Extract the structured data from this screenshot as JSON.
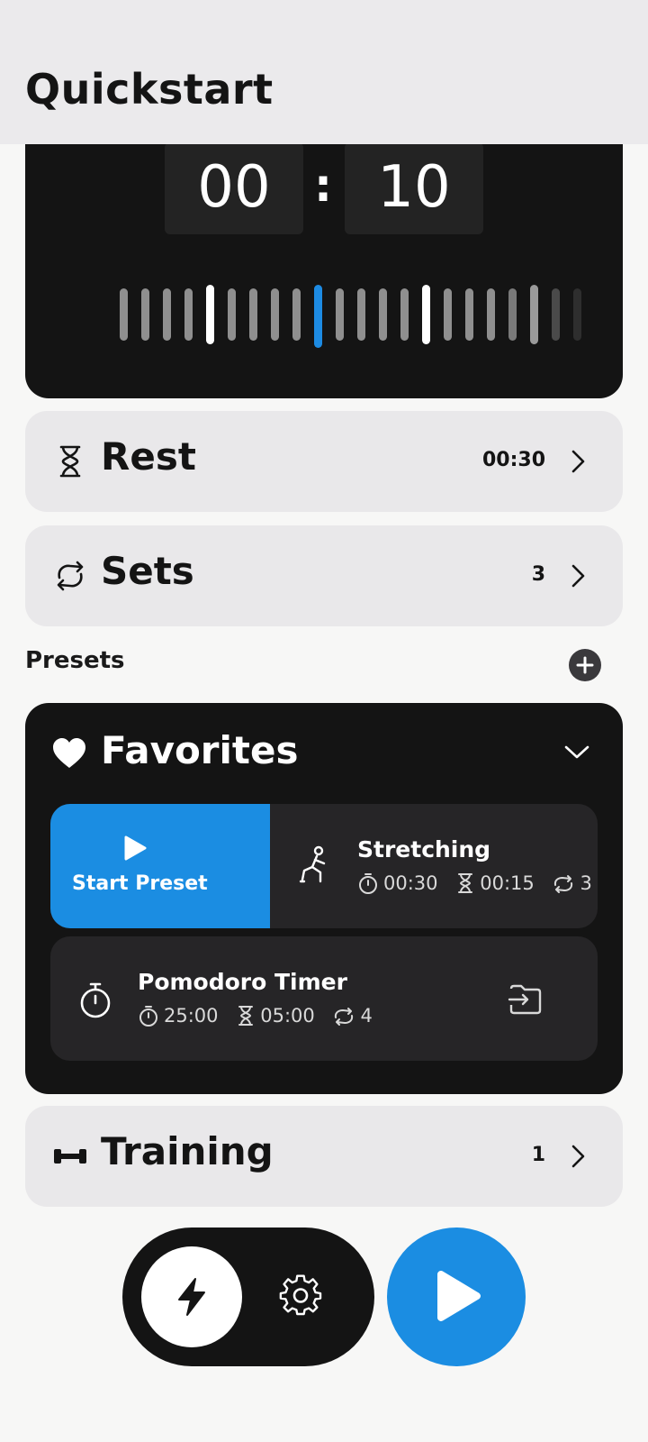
{
  "header": {
    "title": "Quickstart"
  },
  "timer": {
    "minutes": "00",
    "seconds": "10",
    "separator": ":"
  },
  "rest": {
    "icon": "hourglass-icon",
    "label": "Rest",
    "value": "00:30"
  },
  "sets": {
    "icon": "repeat-icon",
    "label": "Sets",
    "value": "3"
  },
  "presets": {
    "title": "Presets",
    "add_icon": "plus-icon"
  },
  "favorites": {
    "icon": "heart-icon",
    "title": "Favorites",
    "items": [
      {
        "name": "Stretching",
        "icon": "stretching-figure-icon",
        "action_label": "Start Preset",
        "work": "00:30",
        "rest": "00:15",
        "sets": "3"
      },
      {
        "name": "Pomodoro Timer",
        "icon": "stopwatch-icon",
        "work": "25:00",
        "rest": "05:00",
        "sets": "4",
        "action_icon": "import-folder-icon"
      }
    ]
  },
  "training": {
    "icon": "dumbbell-icon",
    "label": "Training",
    "value": "1"
  },
  "bottom_bar": {
    "quick_icon": "lightning-icon",
    "settings_icon": "gear-icon",
    "play_icon": "play-icon"
  },
  "colors": {
    "accent": "#1b8de2",
    "dark": "#141414",
    "card": "#e9e8ea"
  }
}
